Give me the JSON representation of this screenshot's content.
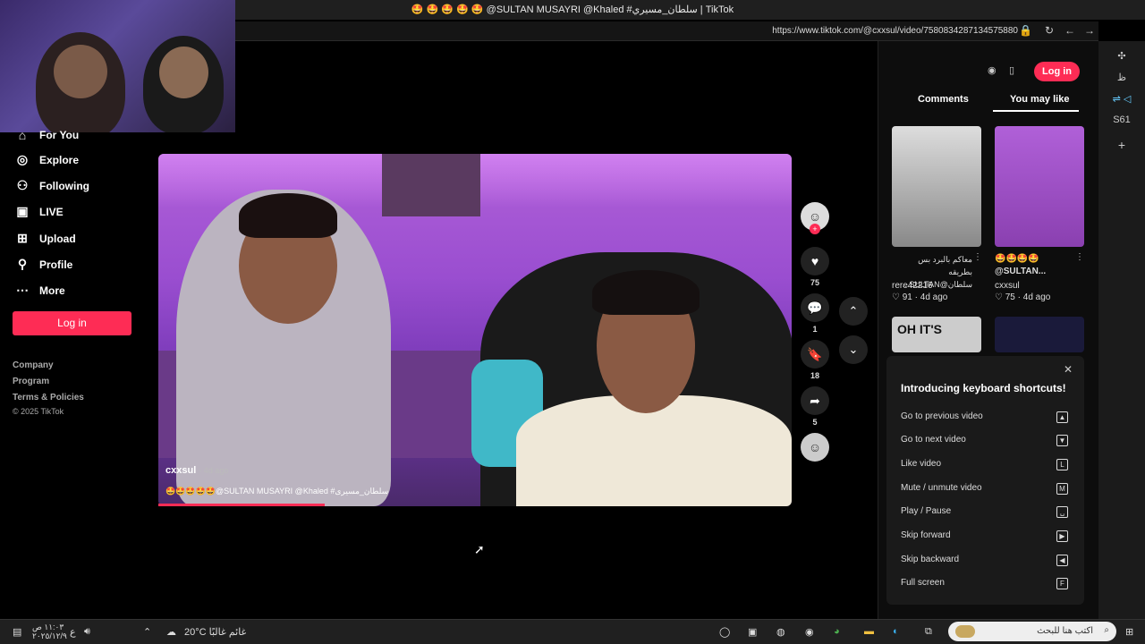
{
  "browser": {
    "title": "🤩 🤩 🤩 🤩 🤩 @SULTAN MUSAYRI @Khaled #سلطان_مسيري | TikTok",
    "url": "https://www.tiktok.com/@cxxsul/video/7580834287134575880"
  },
  "nav": {
    "items": [
      {
        "label": "For You",
        "icon": "home-icon"
      },
      {
        "label": "Explore",
        "icon": "compass-icon"
      },
      {
        "label": "Following",
        "icon": "user-follow-icon"
      },
      {
        "label": "LIVE",
        "icon": "live-icon"
      },
      {
        "label": "Upload",
        "icon": "plus-square-icon"
      },
      {
        "label": "Profile",
        "icon": "person-icon"
      },
      {
        "label": "More",
        "icon": "more-dots-icon"
      }
    ],
    "login_label": "Log in",
    "footer": [
      "Company",
      "Program",
      "Terms & Policies",
      "© 2025 TikTok"
    ]
  },
  "video": {
    "author": "cxxsul",
    "age": "· 4d ago",
    "caption": "🤩🤩🤩🤩🤩@SULTAN MUSAYRI @Khaled #سلطان_مسيرى",
    "progress": 0.26
  },
  "actions": {
    "likes": "75",
    "comments": "1",
    "saves": "18",
    "shares": "5"
  },
  "right": {
    "login_label": "Log in",
    "tabs": [
      "Comments",
      "You may like"
    ],
    "videos": [
      {
        "title": "معاكم بالبرد بس بطريقه سلطان@SULTAN...",
        "author": "rere42216",
        "stats": "♡ 91 · 4d ago"
      },
      {
        "title": "🤩🤩🤩🤩 @SULTAN...",
        "author": "cxxsul",
        "stats": "♡ 75 · 4d ago"
      }
    ],
    "thumb3_text": "OH IT'S"
  },
  "shortcuts": {
    "title": "Introducing keyboard shortcuts!",
    "rows": [
      {
        "label": "Go to previous video",
        "key": "▲"
      },
      {
        "label": "Go to next video",
        "key": "▼"
      },
      {
        "label": "Like video",
        "key": "L"
      },
      {
        "label": "Mute / unmute video",
        "key": "M"
      },
      {
        "label": "Play / Pause",
        "key": "␣"
      },
      {
        "label": "Skip forward",
        "key": "▶"
      },
      {
        "label": "Skip backward",
        "key": "◀"
      },
      {
        "label": "Full screen",
        "key": "F"
      }
    ]
  },
  "taskbar": {
    "search_placeholder": "اكتب هنا للبحث",
    "weather": "20°C  غائم غالبًا",
    "time": "١١:٠٣ ص",
    "date": "٢٠٢٥/١٢/٩"
  },
  "edge_sidebar": {
    "label1": "ظ",
    "label2": "S61"
  },
  "colors": {
    "accent": "#fe2c55"
  }
}
